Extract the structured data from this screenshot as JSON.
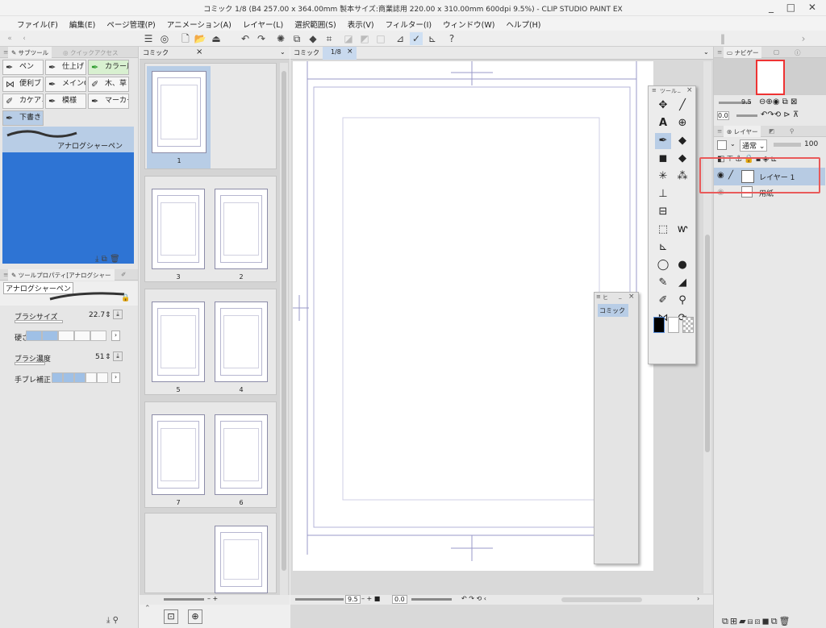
{
  "window": {
    "title": "コミック 1/8 (B4 257.00 x 364.00mm 製本サイズ:商業誌用 220.00 x 310.00mm 600dpi 9.5%) - CLIP STUDIO PAINT EX",
    "controls": "_ □ ✕"
  },
  "menu": [
    "ファイル(F)",
    "編集(E)",
    "ページ管理(P)",
    "アニメーション(A)",
    "レイヤー(L)",
    "選択範囲(S)",
    "表示(V)",
    "フィルター(I)",
    "ウィンドウ(W)",
    "ヘルプ(H)"
  ],
  "left_panel": {
    "tab_subtool": "サブツール",
    "tab_quick": "クイックアクセス",
    "subtools": [
      "ペン",
      "仕上げ",
      "カラー用",
      "便利ブ",
      "メインG",
      "木、草",
      "カケアミ",
      "模様",
      "マーカー",
      "下書き"
    ],
    "selected_brush": "アナログシャーペン",
    "props_tab": "ツールプロパティ[アナログシャー",
    "props_brush": "アナログシャーペン",
    "brush_size_label": "ブラシサイズ",
    "brush_size_value": "22.7",
    "hardness_label": "硬さ",
    "density_label": "ブラシ濃度",
    "density_value": "51",
    "stabilize_label": "手ブレ補正"
  },
  "page_manager": {
    "tab_label": "コミック",
    "page_numbers": [
      "1",
      "3",
      "2",
      "5",
      "4",
      "7",
      "6"
    ],
    "zoom_controls": "– + ",
    "selected_page_fraction": 0.0
  },
  "canvas": {
    "tab_left": "コミック",
    "tab_label": "1/8",
    "zoom": "9.5",
    "angle": "0.0"
  },
  "sub_float": {
    "title": "ヒ",
    "item": "コミック"
  },
  "tool_float": {
    "title": "ツール"
  },
  "right_panel": {
    "navigator_tab": "ナビゲー",
    "nav_zoom": "9.5",
    "nav_angle": "0.0",
    "layer_tab": "レイヤー",
    "blend_mode": "通常",
    "opacity": "100",
    "layers": [
      "レイヤー 1",
      "用紙"
    ]
  },
  "colors": {
    "accent": "#2e74d4",
    "highlight": "#e95a5a",
    "selection": "#b7cbe3"
  }
}
